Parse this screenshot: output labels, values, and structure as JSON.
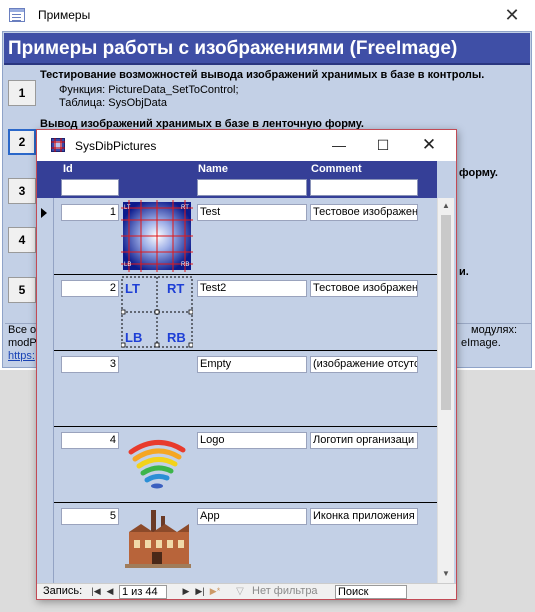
{
  "bg_window": {
    "title": "Примеры",
    "header_title": "Примеры работы с изображениями (FreeImage)",
    "buttons": [
      "1",
      "2",
      "3",
      "4",
      "5"
    ],
    "item1": {
      "heading": "Тестирование возможностей вывода изображений хранимых в базе в контролы.",
      "line1": "Функция: PictureData_SetToControl;",
      "line2": "Таблица: SysObjData"
    },
    "item2_heading": "Вывод изображений хранимых в базе в ленточную форму.",
    "item2_heading_tail": "форму.",
    "item_tail_4": "и.",
    "footer": {
      "line1_start": "Все ос",
      "line1_end": "модулях:",
      "line2_start": "modPi",
      "line2_end": "eImage.",
      "link": "https:"
    }
  },
  "fg_window": {
    "title": "SysDibPictures",
    "minimize_glyph": "—",
    "maximize_glyph": "☐",
    "close_glyph": "✕",
    "columns": [
      "Id",
      "Name",
      "Comment"
    ],
    "rows": [
      {
        "id": "1",
        "name": "Test",
        "comment": "Тестовое изображени",
        "picture": "test-grid-image"
      },
      {
        "id": "2",
        "name": "Test2",
        "comment": "Тестовое изображени",
        "picture": "lt-rt-lb-rb-layout-image",
        "labels": [
          "LT",
          "RT",
          "LB",
          "RB"
        ]
      },
      {
        "id": "3",
        "name": "Empty",
        "comment": "(изображение отсутст",
        "picture": "none"
      },
      {
        "id": "4",
        "name": "Logo",
        "comment": "Логотип организаци",
        "picture": "rainbow-logo-image"
      },
      {
        "id": "5",
        "name": "App",
        "comment": "Иконка приложения",
        "picture": "factory-icon-image"
      }
    ],
    "navigation": {
      "label": "Запись:",
      "position": "1 из 44",
      "filter": "Нет фильтра",
      "search": "Поиск"
    }
  }
}
